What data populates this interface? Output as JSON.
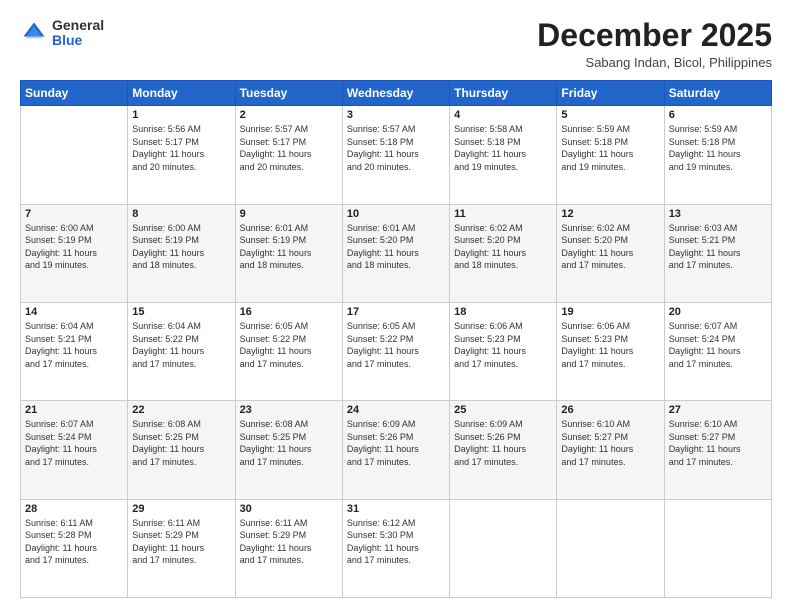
{
  "header": {
    "logo_general": "General",
    "logo_blue": "Blue",
    "month_title": "December 2025",
    "location": "Sabang Indan, Bicol, Philippines"
  },
  "days_of_week": [
    "Sunday",
    "Monday",
    "Tuesday",
    "Wednesday",
    "Thursday",
    "Friday",
    "Saturday"
  ],
  "weeks": [
    [
      {
        "day": "",
        "info": ""
      },
      {
        "day": "1",
        "info": "Sunrise: 5:56 AM\nSunset: 5:17 PM\nDaylight: 11 hours\nand 20 minutes."
      },
      {
        "day": "2",
        "info": "Sunrise: 5:57 AM\nSunset: 5:17 PM\nDaylight: 11 hours\nand 20 minutes."
      },
      {
        "day": "3",
        "info": "Sunrise: 5:57 AM\nSunset: 5:18 PM\nDaylight: 11 hours\nand 20 minutes."
      },
      {
        "day": "4",
        "info": "Sunrise: 5:58 AM\nSunset: 5:18 PM\nDaylight: 11 hours\nand 19 minutes."
      },
      {
        "day": "5",
        "info": "Sunrise: 5:59 AM\nSunset: 5:18 PM\nDaylight: 11 hours\nand 19 minutes."
      },
      {
        "day": "6",
        "info": "Sunrise: 5:59 AM\nSunset: 5:18 PM\nDaylight: 11 hours\nand 19 minutes."
      }
    ],
    [
      {
        "day": "7",
        "info": "Sunrise: 6:00 AM\nSunset: 5:19 PM\nDaylight: 11 hours\nand 19 minutes."
      },
      {
        "day": "8",
        "info": "Sunrise: 6:00 AM\nSunset: 5:19 PM\nDaylight: 11 hours\nand 18 minutes."
      },
      {
        "day": "9",
        "info": "Sunrise: 6:01 AM\nSunset: 5:19 PM\nDaylight: 11 hours\nand 18 minutes."
      },
      {
        "day": "10",
        "info": "Sunrise: 6:01 AM\nSunset: 5:20 PM\nDaylight: 11 hours\nand 18 minutes."
      },
      {
        "day": "11",
        "info": "Sunrise: 6:02 AM\nSunset: 5:20 PM\nDaylight: 11 hours\nand 18 minutes."
      },
      {
        "day": "12",
        "info": "Sunrise: 6:02 AM\nSunset: 5:20 PM\nDaylight: 11 hours\nand 17 minutes."
      },
      {
        "day": "13",
        "info": "Sunrise: 6:03 AM\nSunset: 5:21 PM\nDaylight: 11 hours\nand 17 minutes."
      }
    ],
    [
      {
        "day": "14",
        "info": "Sunrise: 6:04 AM\nSunset: 5:21 PM\nDaylight: 11 hours\nand 17 minutes."
      },
      {
        "day": "15",
        "info": "Sunrise: 6:04 AM\nSunset: 5:22 PM\nDaylight: 11 hours\nand 17 minutes."
      },
      {
        "day": "16",
        "info": "Sunrise: 6:05 AM\nSunset: 5:22 PM\nDaylight: 11 hours\nand 17 minutes."
      },
      {
        "day": "17",
        "info": "Sunrise: 6:05 AM\nSunset: 5:22 PM\nDaylight: 11 hours\nand 17 minutes."
      },
      {
        "day": "18",
        "info": "Sunrise: 6:06 AM\nSunset: 5:23 PM\nDaylight: 11 hours\nand 17 minutes."
      },
      {
        "day": "19",
        "info": "Sunrise: 6:06 AM\nSunset: 5:23 PM\nDaylight: 11 hours\nand 17 minutes."
      },
      {
        "day": "20",
        "info": "Sunrise: 6:07 AM\nSunset: 5:24 PM\nDaylight: 11 hours\nand 17 minutes."
      }
    ],
    [
      {
        "day": "21",
        "info": "Sunrise: 6:07 AM\nSunset: 5:24 PM\nDaylight: 11 hours\nand 17 minutes."
      },
      {
        "day": "22",
        "info": "Sunrise: 6:08 AM\nSunset: 5:25 PM\nDaylight: 11 hours\nand 17 minutes."
      },
      {
        "day": "23",
        "info": "Sunrise: 6:08 AM\nSunset: 5:25 PM\nDaylight: 11 hours\nand 17 minutes."
      },
      {
        "day": "24",
        "info": "Sunrise: 6:09 AM\nSunset: 5:26 PM\nDaylight: 11 hours\nand 17 minutes."
      },
      {
        "day": "25",
        "info": "Sunrise: 6:09 AM\nSunset: 5:26 PM\nDaylight: 11 hours\nand 17 minutes."
      },
      {
        "day": "26",
        "info": "Sunrise: 6:10 AM\nSunset: 5:27 PM\nDaylight: 11 hours\nand 17 minutes."
      },
      {
        "day": "27",
        "info": "Sunrise: 6:10 AM\nSunset: 5:27 PM\nDaylight: 11 hours\nand 17 minutes."
      }
    ],
    [
      {
        "day": "28",
        "info": "Sunrise: 6:11 AM\nSunset: 5:28 PM\nDaylight: 11 hours\nand 17 minutes."
      },
      {
        "day": "29",
        "info": "Sunrise: 6:11 AM\nSunset: 5:29 PM\nDaylight: 11 hours\nand 17 minutes."
      },
      {
        "day": "30",
        "info": "Sunrise: 6:11 AM\nSunset: 5:29 PM\nDaylight: 11 hours\nand 17 minutes."
      },
      {
        "day": "31",
        "info": "Sunrise: 6:12 AM\nSunset: 5:30 PM\nDaylight: 11 hours\nand 17 minutes."
      },
      {
        "day": "",
        "info": ""
      },
      {
        "day": "",
        "info": ""
      },
      {
        "day": "",
        "info": ""
      }
    ]
  ]
}
